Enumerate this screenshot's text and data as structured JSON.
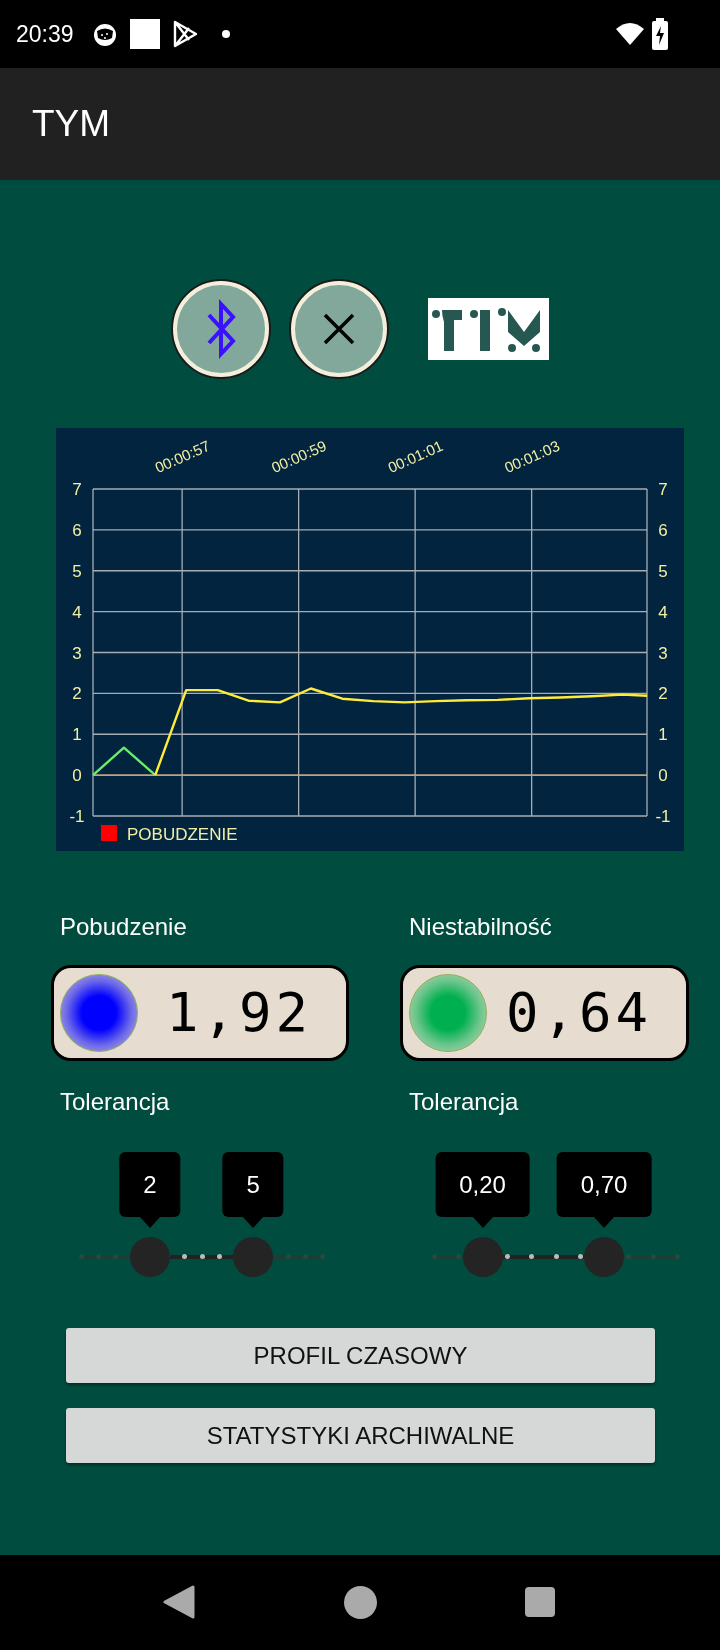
{
  "status_bar": {
    "time": "20:39"
  },
  "app_bar": {
    "title": "TYM"
  },
  "chart": {
    "legend": {
      "color": "#ff0000"
    },
    "left_axis_labels": [
      "7",
      "6",
      "5",
      "4",
      "3",
      "2",
      "1",
      "0",
      "-1"
    ],
    "right_axis_labels": [
      "7",
      "6",
      "5",
      "4",
      "3",
      "2",
      "1",
      "0",
      "-1"
    ],
    "chart_data": {
      "type": "line",
      "x": [
        55.47,
        56.0,
        56.54,
        57.07,
        57.61,
        58.14,
        58.68,
        59.21,
        59.75,
        60.28,
        60.82,
        61.35,
        61.89,
        62.42,
        62.96,
        63.49,
        64.03,
        64.56,
        64.98
      ],
      "series": [
        {
          "color": "#66ee66",
          "values": [
            0,
            0.67,
            0,
            null,
            null,
            null,
            null,
            null,
            null,
            null,
            null,
            null,
            null,
            null,
            null,
            null,
            null,
            null,
            null
          ]
        },
        {
          "name": "POBUDZENIE",
          "color": "#ffeb3b",
          "values": [
            null,
            null,
            0,
            2.08,
            2.08,
            1.82,
            1.78,
            2.12,
            1.87,
            1.81,
            1.78,
            1.81,
            1.83,
            1.84,
            1.88,
            1.9,
            1.93,
            1.97,
            1.94
          ]
        }
      ],
      "xlim": [
        55.47,
        64.98
      ],
      "ylim": [
        -1,
        7
      ],
      "xticks": [
        {
          "value": 57,
          "label": "00:00:57"
        },
        {
          "value": 59,
          "label": "00:00:59"
        },
        {
          "value": 61,
          "label": "00:01:01"
        },
        {
          "value": 63,
          "label": "00:01:03"
        }
      ],
      "yticks": [
        -1,
        0,
        1,
        2,
        3,
        4,
        5,
        6,
        7
      ],
      "grid": true,
      "ref_lines": [
        {
          "axis": "y",
          "value": 0,
          "color": "#c9a46a"
        }
      ]
    }
  },
  "readouts": [
    {
      "label": "Pobudzenie",
      "value": "1,92",
      "color": "#0000ff"
    },
    {
      "label": "Niestabilność",
      "value": "0,64",
      "color": "#00b050"
    }
  ],
  "tolerances": [
    {
      "label": "Tolerancja",
      "handles": [
        {
          "value": "2",
          "level": 0.286
        },
        {
          "value": "5",
          "level": 0.714
        }
      ]
    },
    {
      "label": "Tolerancja",
      "handles": [
        {
          "value": "0,20",
          "level": 0.2
        },
        {
          "value": "0,70",
          "level": 0.7
        }
      ]
    }
  ],
  "buttons": [
    "PROFIL CZASOWY",
    "STATYSTYKI ARCHIWALNE"
  ]
}
